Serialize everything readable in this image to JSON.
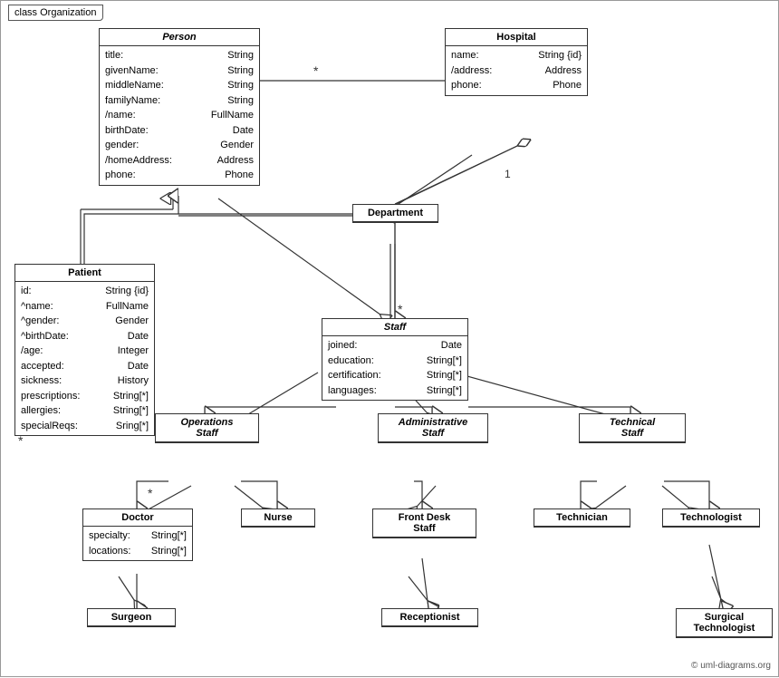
{
  "title": "class Organization",
  "copyright": "© uml-diagrams.org",
  "boxes": {
    "person": {
      "title": "Person",
      "attrs": [
        {
          "name": "title:",
          "type": "String"
        },
        {
          "name": "givenName:",
          "type": "String"
        },
        {
          "name": "middleName:",
          "type": "String"
        },
        {
          "name": "familyName:",
          "type": "String"
        },
        {
          "name": "/name:",
          "type": "FullName"
        },
        {
          "name": "birthDate:",
          "type": "Date"
        },
        {
          "name": "gender:",
          "type": "Gender"
        },
        {
          "name": "/homeAddress:",
          "type": "Address"
        },
        {
          "name": "phone:",
          "type": "Phone"
        }
      ]
    },
    "hospital": {
      "title": "Hospital",
      "attrs": [
        {
          "name": "name:",
          "type": "String {id}"
        },
        {
          "name": "/address:",
          "type": "Address"
        },
        {
          "name": "phone:",
          "type": "Phone"
        }
      ]
    },
    "patient": {
      "title": "Patient",
      "attrs": [
        {
          "name": "id:",
          "type": "String {id}"
        },
        {
          "name": "^name:",
          "type": "FullName"
        },
        {
          "name": "^gender:",
          "type": "Gender"
        },
        {
          "name": "^birthDate:",
          "type": "Date"
        },
        {
          "name": "/age:",
          "type": "Integer"
        },
        {
          "name": "accepted:",
          "type": "Date"
        },
        {
          "name": "sickness:",
          "type": "History"
        },
        {
          "name": "prescriptions:",
          "type": "String[*]"
        },
        {
          "name": "allergies:",
          "type": "String[*]"
        },
        {
          "name": "specialReqs:",
          "type": "Sring[*]"
        }
      ]
    },
    "department": {
      "title": "Department"
    },
    "staff": {
      "title": "Staff",
      "attrs": [
        {
          "name": "joined:",
          "type": "Date"
        },
        {
          "name": "education:",
          "type": "String[*]"
        },
        {
          "name": "certification:",
          "type": "String[*]"
        },
        {
          "name": "languages:",
          "type": "String[*]"
        }
      ]
    },
    "operations_staff": {
      "title": "Operations\nStaff"
    },
    "administrative_staff": {
      "title": "Administrative\nStaff"
    },
    "technical_staff": {
      "title": "Technical\nStaff"
    },
    "doctor": {
      "title": "Doctor",
      "attrs": [
        {
          "name": "specialty:",
          "type": "String[*]"
        },
        {
          "name": "locations:",
          "type": "String[*]"
        }
      ]
    },
    "nurse": {
      "title": "Nurse"
    },
    "front_desk_staff": {
      "title": "Front Desk\nStaff"
    },
    "technician": {
      "title": "Technician"
    },
    "technologist": {
      "title": "Technologist"
    },
    "surgeon": {
      "title": "Surgeon"
    },
    "receptionist": {
      "title": "Receptionist"
    },
    "surgical_technologist": {
      "title": "Surgical\nTechnologist"
    }
  }
}
